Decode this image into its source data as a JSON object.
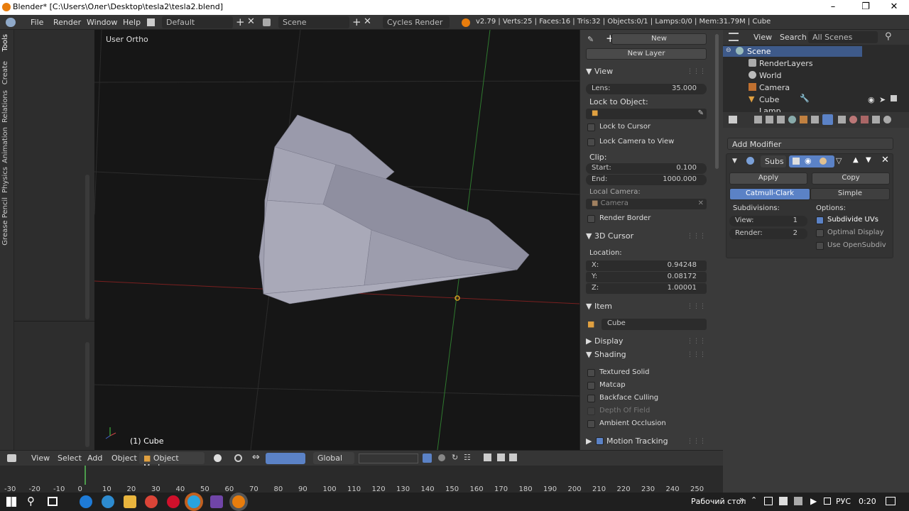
{
  "window": {
    "title": "Blender* [C:\\Users\\Олег\\Desktop\\tesla2\\tesla2.blend]"
  },
  "menubar": {
    "menus": [
      "File",
      "Render",
      "Window",
      "Help"
    ],
    "layout": "Default",
    "scene": "Scene",
    "engine": "Cycles Render",
    "stats": "v2.79 | Verts:25 | Faces:16 | Tris:32 | Objects:0/1 | Lamps:0/0 | Mem:31.79M | Cube"
  },
  "left_tabs": [
    "Tools",
    "Create",
    "Relations",
    "Animation",
    "Physics",
    "Grease Pencil"
  ],
  "viewport": {
    "view_label": "User Ortho",
    "object_label": "(1) Cube"
  },
  "npanel": {
    "new_btn": "New",
    "new_layer_btn": "New Layer",
    "view_header": "View",
    "lens_label": "Lens:",
    "lens_value": "35.000",
    "lock_to_object": "Lock to Object:",
    "lock_to_cursor": "Lock to Cursor",
    "lock_camera": "Lock Camera to View",
    "clip": "Clip:",
    "start_label": "Start:",
    "start_value": "0.100",
    "end_label": "End:",
    "end_value": "1000.000",
    "local_camera": "Local Camera:",
    "camera_field": "Camera",
    "render_border": "Render Border",
    "cursor_header": "3D Cursor",
    "location": "Location:",
    "x_label": "X:",
    "x_value": "0.94248",
    "y_label": "Y:",
    "y_value": "0.08172",
    "z_label": "Z:",
    "z_value": "1.00001",
    "item_header": "Item",
    "item_name": "Cube",
    "display_header": "Display",
    "shading_header": "Shading",
    "textured_solid": "Textured Solid",
    "matcap": "Matcap",
    "backface": "Backface Culling",
    "dof": "Depth Of Field",
    "ao": "Ambient Occlusion",
    "motion_tracking": "Motion Tracking"
  },
  "outliner": {
    "view": "View",
    "search": "Search",
    "filter": "All Scenes",
    "items": [
      "Scene",
      "RenderLayers",
      "World",
      "Camera",
      "Cube",
      "Lamp"
    ]
  },
  "properties": {
    "add_modifier": "Add Modifier",
    "mod_name": "Subs",
    "apply": "Apply",
    "copy": "Copy",
    "catmull": "Catmull-Clark",
    "simple": "Simple",
    "subdivisions": "Subdivisions:",
    "view_label": "View:",
    "view_value": "1",
    "render_label": "Render:",
    "render_value": "2",
    "options": "Options:",
    "subdivide_uvs": "Subdivide UVs",
    "optimal_display": "Optimal Display",
    "use_opensubdiv": "Use OpenSubdiv"
  },
  "view_header": {
    "menus": [
      "View",
      "Select",
      "Add",
      "Object"
    ],
    "mode": "Object Mode",
    "orientation": "Global"
  },
  "timeline": {
    "ticks": [
      "-30",
      "-20",
      "-10",
      "0",
      "10",
      "20",
      "30",
      "40",
      "50",
      "60",
      "70",
      "80",
      "90",
      "100",
      "110",
      "120",
      "130",
      "140",
      "150",
      "160",
      "170",
      "180",
      "190",
      "200",
      "210",
      "220",
      "230",
      "240",
      "250"
    ]
  },
  "taskbar": {
    "desktop": "Рабочий стол",
    "lang": "РУС",
    "time": "0:20"
  }
}
